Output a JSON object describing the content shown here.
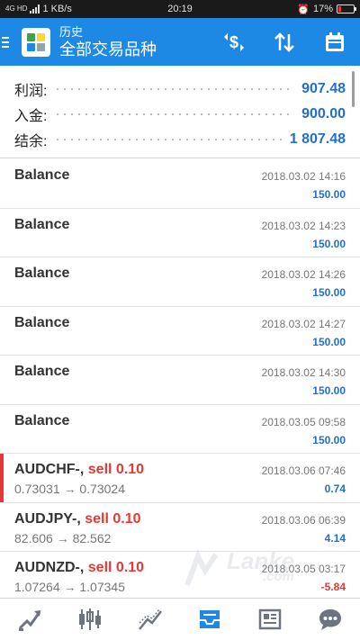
{
  "status": {
    "network": "4G HD",
    "speed": "1 KB/s",
    "time": "20:19",
    "battery": "17%",
    "battery_level": 0.17
  },
  "header": {
    "title1": "历史",
    "title2": "全部交易品种"
  },
  "summary": [
    {
      "label": "利润:",
      "value": "907.48"
    },
    {
      "label": "入金:",
      "value": "900.00"
    },
    {
      "label": "结余:",
      "value": "1 807.48"
    }
  ],
  "history": [
    {
      "name": "Balance",
      "date": "2018.03.02 14:16",
      "amount": "150.00"
    },
    {
      "name": "Balance",
      "date": "2018.03.02 14:23",
      "amount": "150.00"
    },
    {
      "name": "Balance",
      "date": "2018.03.02 14:26",
      "amount": "150.00"
    },
    {
      "name": "Balance",
      "date": "2018.03.02 14:27",
      "amount": "150.00"
    },
    {
      "name": "Balance",
      "date": "2018.03.02 14:30",
      "amount": "150.00"
    },
    {
      "name": "Balance",
      "date": "2018.03.05 09:58",
      "amount": "150.00"
    }
  ],
  "trades": [
    {
      "symbol": "AUDCHF-,",
      "side": "sell 0.10",
      "prices": "0.73031 → 0.73024",
      "date": "2018.03.06 07:46",
      "profit": "0.74"
    },
    {
      "symbol": "AUDJPY-,",
      "side": "sell 0.10",
      "prices": "82.606 → 82.562",
      "date": "2018.03.06 06:39",
      "profit": "4.14"
    },
    {
      "symbol": "AUDNZD-,",
      "side": "sell 0.10",
      "prices": "1.07264 → 1.07345",
      "date": "2018.03.05 03:17",
      "profit": "-5.84"
    }
  ],
  "watermark": {
    "brand": "Lanke",
    "sub": ".com"
  },
  "nav": [
    {
      "icon": "trade-chart-icon"
    },
    {
      "icon": "candlestick-icon"
    },
    {
      "icon": "line-chart-icon"
    },
    {
      "icon": "history-inbox-icon"
    },
    {
      "icon": "news-icon"
    },
    {
      "icon": "chat-icon"
    }
  ],
  "colors": {
    "accent": "#1e88e5",
    "value": "#1e6fd0",
    "sell": "#e53935"
  }
}
